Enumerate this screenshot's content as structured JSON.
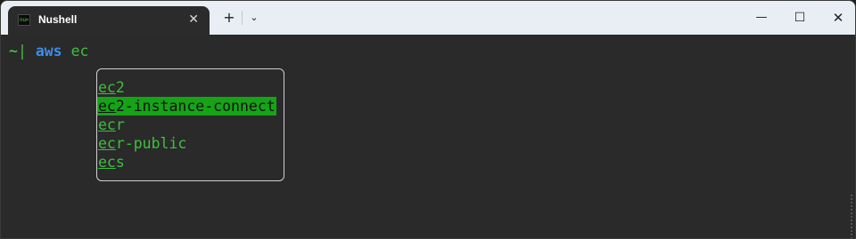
{
  "tab": {
    "icon_text": "nu>",
    "title": "Nushell",
    "close_glyph": "✕"
  },
  "toolbar": {
    "new_tab_glyph": "+",
    "dropdown_glyph": "⌄"
  },
  "window_controls": {
    "minimize_glyph": "—",
    "maximize_glyph": "☐",
    "close_glyph": "✕"
  },
  "terminal": {
    "prompt_tilde": "~",
    "prompt_sep": "|",
    "command": "aws",
    "argument": "ec",
    "completion_menu": {
      "items": [
        {
          "match": "ec",
          "rest": "2",
          "selected": false
        },
        {
          "match": "ec",
          "rest": "2-instance-connect",
          "selected": true
        },
        {
          "match": "ec",
          "rest": "r",
          "selected": false
        },
        {
          "match": "ec",
          "rest": "r-public",
          "selected": false
        },
        {
          "match": "ec",
          "rest": "s",
          "selected": false
        }
      ]
    }
  },
  "colors": {
    "prompt_green": "#3fbf3f",
    "command_blue": "#3b8eea",
    "selection_bg": "#16a316",
    "titlebar_bg": "#e9eef5",
    "terminal_bg": "#2a2a2a"
  }
}
